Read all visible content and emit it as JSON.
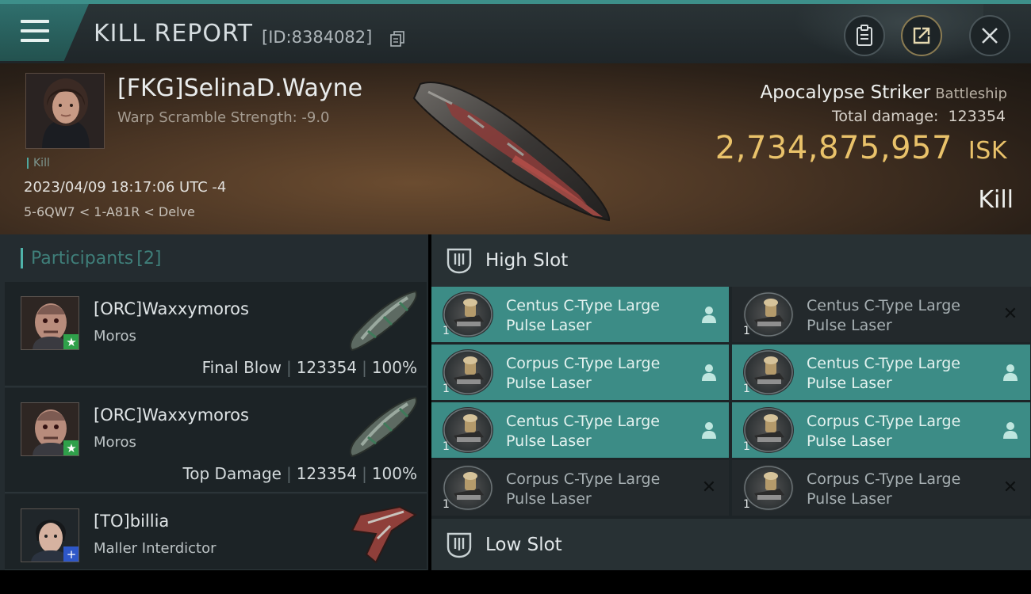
{
  "header": {
    "title": "KILL REPORT",
    "report_id": "[ID:8384082]",
    "icons": [
      "menu-icon",
      "copy-icon",
      "clipboard-icon",
      "share-icon",
      "close-icon"
    ]
  },
  "victim": {
    "name": "[FKG]SelinaD.Wayne",
    "warp_scramble": "Warp Scramble Strength: -9.0",
    "kill_tag": "Kill",
    "datetime": "2023/04/09 18:17:06 UTC -4",
    "location": "5-6QW7 < 1-A81R < Delve",
    "ship_name": "Apocalypse Striker",
    "ship_class": "Battleship",
    "total_damage_label": "Total damage:",
    "total_damage": "123354",
    "isk_value": "2,734,875,957",
    "isk_unit": "ISK",
    "result": "Kill"
  },
  "participants": {
    "label": "Participants",
    "count": "[2]",
    "items": [
      {
        "name": "[ORC]Waxxymoros",
        "ship": "Moros",
        "role": "Final Blow",
        "damage": "123354",
        "percent": "100%",
        "badge": "★"
      },
      {
        "name": "[ORC]Waxxymoros",
        "ship": "Moros",
        "role": "Top Damage",
        "damage": "123354",
        "percent": "100%",
        "badge": "★"
      },
      {
        "name": "[TO]billia",
        "ship": "Maller Interdictor",
        "role": "",
        "damage": "",
        "percent": "",
        "badge": "+"
      }
    ]
  },
  "fitting": {
    "high_slot_label": "High Slot",
    "low_slot_label": "Low Slot",
    "high_slot": [
      {
        "line1": "Centus C-Type Large",
        "line2": "Pulse Laser",
        "qty": "1",
        "status": "fitted"
      },
      {
        "line1": "Centus C-Type Large",
        "line2": "Pulse Laser",
        "qty": "1",
        "status": "dropped"
      },
      {
        "line1": "Corpus C-Type Large",
        "line2": "Pulse Laser",
        "qty": "1",
        "status": "fitted"
      },
      {
        "line1": "Centus C-Type Large",
        "line2": "Pulse Laser",
        "qty": "1",
        "status": "fitted"
      },
      {
        "line1": "Centus C-Type Large",
        "line2": "Pulse Laser",
        "qty": "1",
        "status": "fitted"
      },
      {
        "line1": "Corpus C-Type Large",
        "line2": "Pulse Laser",
        "qty": "1",
        "status": "fitted"
      },
      {
        "line1": "Corpus C-Type Large",
        "line2": "Pulse Laser",
        "qty": "1",
        "status": "dropped"
      },
      {
        "line1": "Corpus C-Type Large",
        "line2": "Pulse Laser",
        "qty": "1",
        "status": "dropped"
      }
    ]
  },
  "colors": {
    "accent_teal": "#3c8c86",
    "isk_gold": "#e9c26a",
    "panel_dark": "#1d2427"
  }
}
